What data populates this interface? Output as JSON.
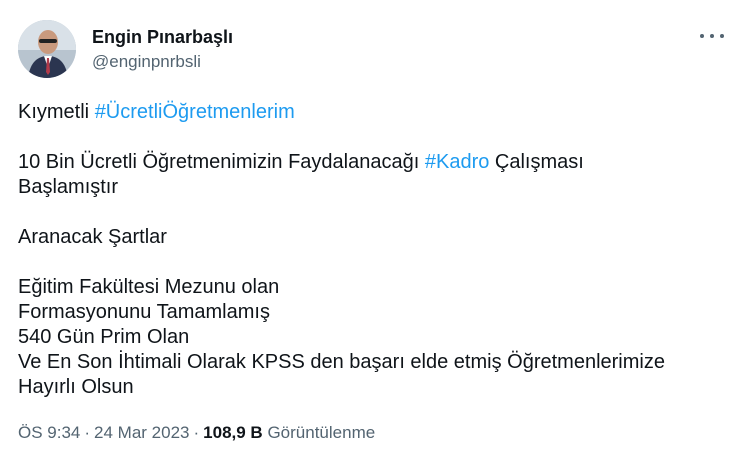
{
  "author": {
    "display_name": "Engin Pınarbaşlı",
    "handle": "@enginpnrbsli"
  },
  "tweet": {
    "line1_prefix": "Kıymetli ",
    "line1_hashtag": "#ÜcretliÖğretmenlerim",
    "line2_prefix": "10 Bin Ücretli Öğretmenimizin Faydalanacağı ",
    "line2_hashtag": "#Kadro",
    "line2_suffix": " Çalışması",
    "line3": "Başlamıştır",
    "line4": "Aranacak Şartlar",
    "line5": "Eğitim Fakültesi Mezunu olan",
    "line6": "Formasyonunu Tamamlamış",
    "line7": "540 Gün Prim Olan",
    "line8": "Ve En Son İhtimali Olarak KPSS den başarı elde etmiş Öğretmenlerimize",
    "line9": "Hayırlı Olsun"
  },
  "meta": {
    "time": "ÖS 9:34",
    "separator": "·",
    "date": "24 Mar 2023",
    "views_count": "108,9 B",
    "views_label": "Görüntülenme"
  },
  "icons": {
    "more": "more-horizontal-icon"
  },
  "colors": {
    "hashtag": "#1d9bf0",
    "secondary_text": "#536471",
    "primary_text": "#0f1419"
  }
}
